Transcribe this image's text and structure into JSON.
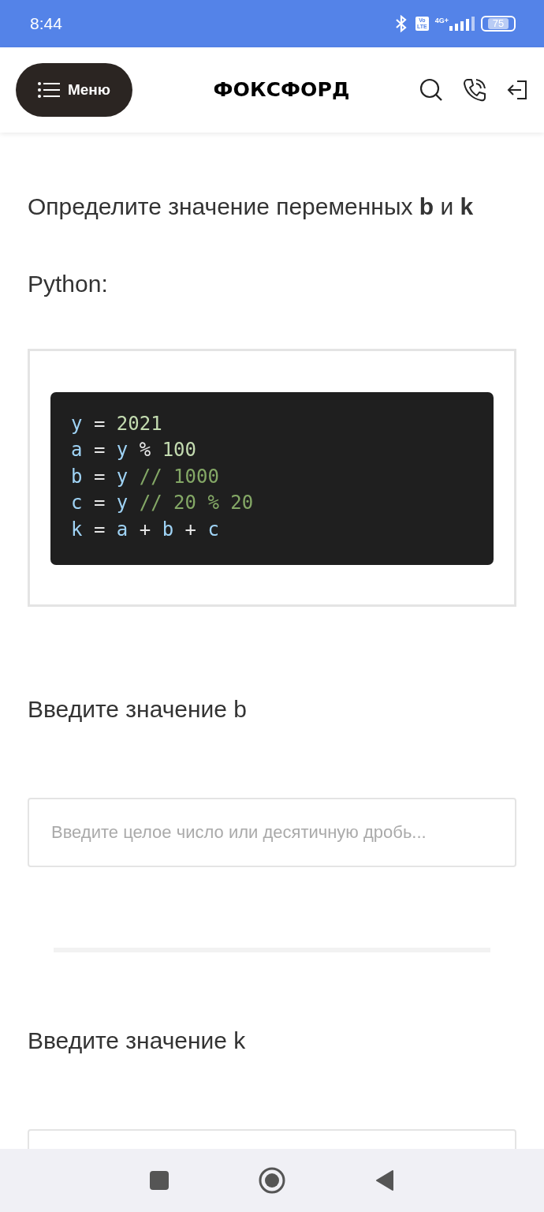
{
  "status_bar": {
    "time": "8:44",
    "volte": {
      "top": "Vo",
      "bottom": "LTE"
    },
    "network": "4G+",
    "battery": "75"
  },
  "header": {
    "menu_button": "Меню",
    "logo": "ФОКСФОРД"
  },
  "question": {
    "title": "Определите значение переменных **b** и **k**",
    "language": "Python:",
    "code": [
      [
        {
          "kind": "name",
          "text": "y"
        },
        {
          "kind": "op",
          "text": " = "
        },
        {
          "kind": "num",
          "text": "2021"
        }
      ],
      [
        {
          "kind": "name",
          "text": "a"
        },
        {
          "kind": "op",
          "text": " = "
        },
        {
          "kind": "name",
          "text": "y"
        },
        {
          "kind": "op",
          "text": " % "
        },
        {
          "kind": "num",
          "text": "100"
        }
      ],
      [
        {
          "kind": "name",
          "text": "b"
        },
        {
          "kind": "op",
          "text": " = "
        },
        {
          "kind": "name",
          "text": "y"
        },
        {
          "kind": "expr",
          "text": " // 1000"
        }
      ],
      [
        {
          "kind": "name",
          "text": "c"
        },
        {
          "kind": "op",
          "text": " = "
        },
        {
          "kind": "name",
          "text": "y"
        },
        {
          "kind": "expr",
          "text": " // 20 % 20"
        }
      ],
      [
        {
          "kind": "name",
          "text": "k"
        },
        {
          "kind": "op",
          "text": " = "
        },
        {
          "kind": "name",
          "text": "a"
        },
        {
          "kind": "op",
          "text": " + "
        },
        {
          "kind": "name",
          "text": "b"
        },
        {
          "kind": "op",
          "text": " + "
        },
        {
          "kind": "name",
          "text": "c"
        }
      ]
    ]
  },
  "answers": [
    {
      "label": "Введите значение b",
      "placeholder": "Введите целое число или десятичную дробь..."
    },
    {
      "label": "Введите значение k"
    }
  ]
}
